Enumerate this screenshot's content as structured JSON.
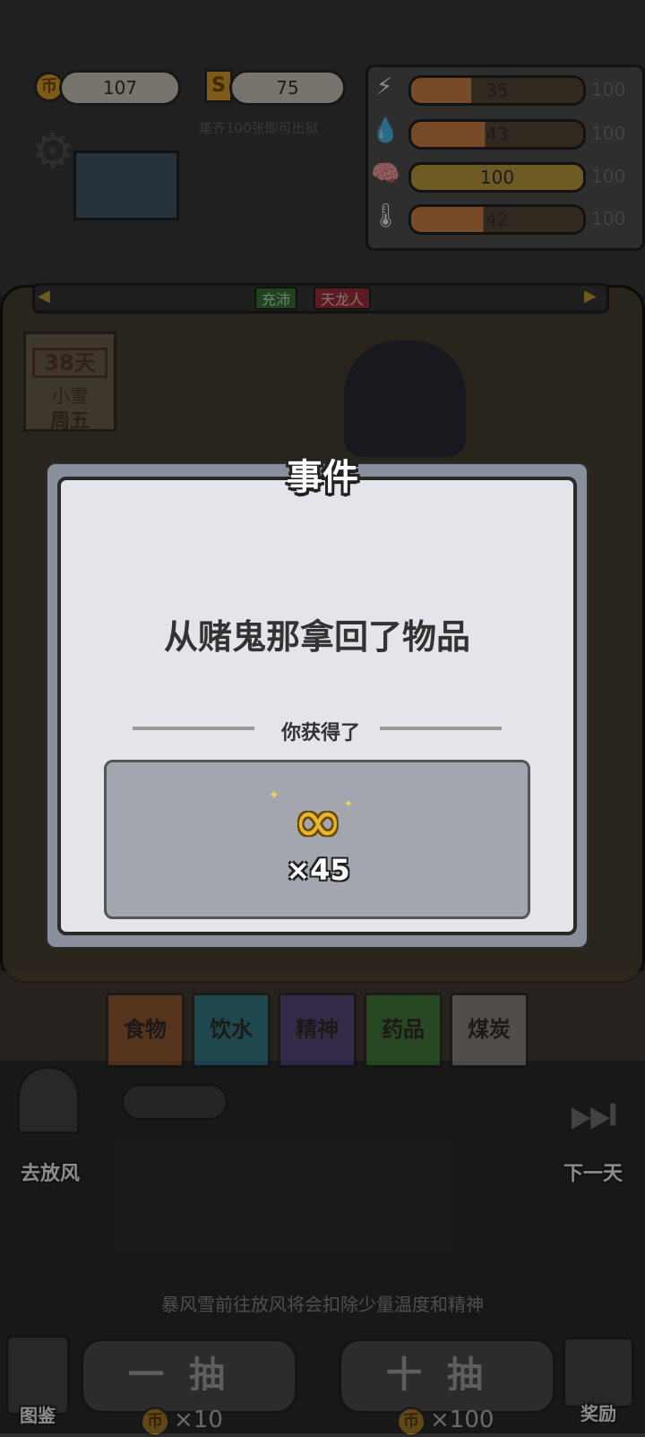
{
  "currency": {
    "coins": "107",
    "tickets": "75",
    "ticket_hint": "集齐100张即可出狱",
    "coin_symbol": "币",
    "ticket_symbol": "S"
  },
  "stats": [
    {
      "icon": "lightning-icon",
      "glyph": "⚡",
      "value": "35",
      "max": "100",
      "color": "#d9884a",
      "fill": 0.35
    },
    {
      "icon": "water-drop-icon",
      "glyph": "💧",
      "value": "43",
      "max": "100",
      "color": "#d9884a",
      "fill": 0.43
    },
    {
      "icon": "brain-icon",
      "glyph": "🧠",
      "value": "100",
      "max": "100",
      "color": "#c9a540",
      "fill": 1.0
    },
    {
      "icon": "thermometer-icon",
      "glyph": "🌡",
      "value": "42",
      "max": "100",
      "color": "#d9884a",
      "fill": 0.42
    }
  ],
  "status_tags": {
    "tag1": "充沛",
    "tag2": "天龙人"
  },
  "calendar": {
    "day": "38天",
    "weather": "小雪",
    "weekday": "周五"
  },
  "modal": {
    "title": "事件",
    "message": "从赌鬼那拿回了物品",
    "subtitle": "你获得了",
    "reward_quantity": "×45",
    "reward_icon": "infinity-icon"
  },
  "resource_tabs": [
    {
      "label": "食物",
      "color": "#e07a3a"
    },
    {
      "label": "饮水",
      "color": "#2fb8d8"
    },
    {
      "label": "精神",
      "color": "#7a5cc8"
    },
    {
      "label": "药品",
      "color": "#4cb84c"
    },
    {
      "label": "煤炭",
      "color": "#cfcfcf"
    }
  ],
  "bottom": {
    "go_out": "去放风",
    "next_day": "下一天",
    "hint": "暴风雪前往放风将会扣除少量温度和精神",
    "single_draw": "一抽",
    "single_cost": "×10",
    "ten_draw": "十抽",
    "ten_cost": "×100",
    "codex": "图鉴",
    "rewards": "奖励"
  }
}
